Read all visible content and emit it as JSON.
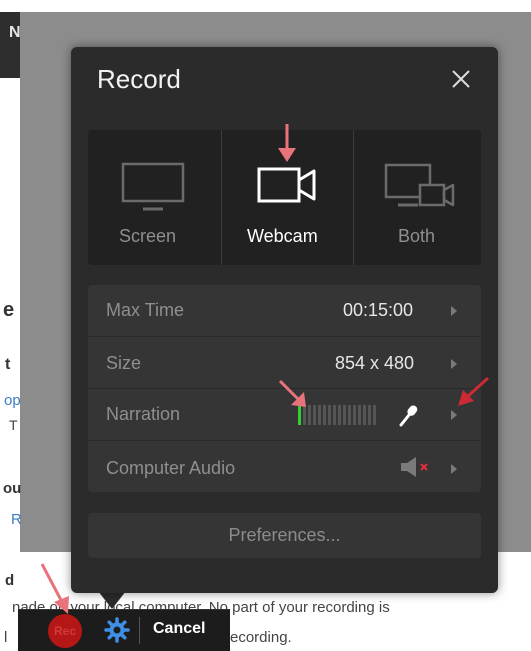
{
  "background_page": {
    "header_letter": "N",
    "line1": "nade on your local computer. No part of your recording is",
    "line2": "ecording.",
    "fragments": [
      "e",
      "t",
      "op",
      "T",
      "ou",
      "R",
      "d",
      "l"
    ]
  },
  "toolbar": {
    "record_label": "Rec",
    "cancel_label": "Cancel"
  },
  "dialog": {
    "title": "Record",
    "sources": [
      {
        "label": "Screen",
        "selected": false
      },
      {
        "label": "Webcam",
        "selected": true
      },
      {
        "label": "Both",
        "selected": false
      }
    ],
    "settings": [
      {
        "label": "Max Time",
        "value": "00:15:00"
      },
      {
        "label": "Size",
        "value": "854 x 480"
      },
      {
        "label": "Narration",
        "value": ""
      },
      {
        "label": "Computer Audio",
        "value": ""
      }
    ],
    "narration_level": 0.07,
    "preferences_label": "Preferences..."
  },
  "colors": {
    "dialog_bg": "#2b2b2b",
    "tile_bg": "#212121",
    "row_bg": "#353535",
    "annotation_arrow": "#e8737b",
    "record_red": "#b51616",
    "level_green": "#2fd12f",
    "gear_blue": "#3f8fe6"
  },
  "icons": [
    "monitor-icon",
    "webcam-icon",
    "screen-and-webcam-icon",
    "close-icon",
    "microphone-icon",
    "speaker-muted-icon",
    "gear-icon",
    "chevron-right-icon"
  ]
}
